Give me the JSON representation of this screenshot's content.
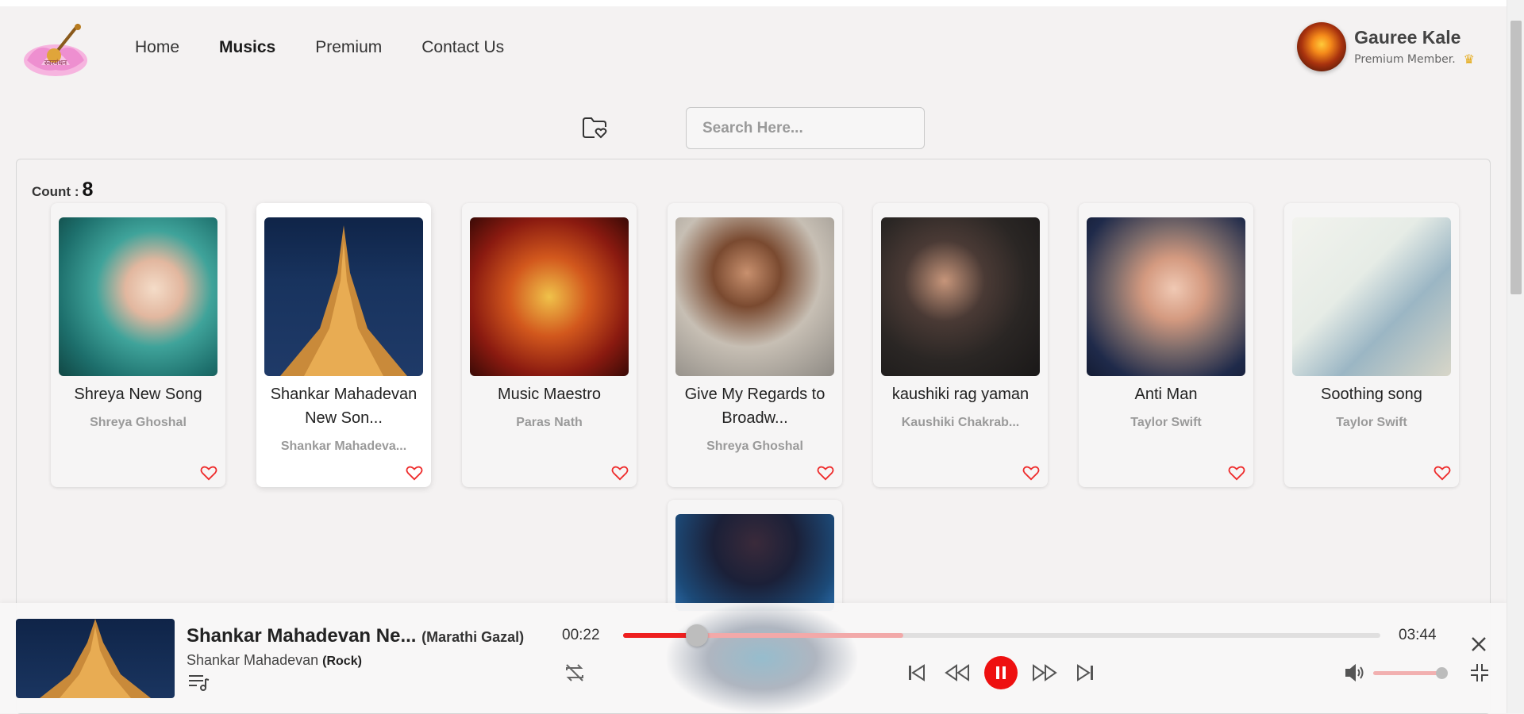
{
  "brand": {
    "logo_text": "स्वरमंथन"
  },
  "nav": {
    "items": [
      "Home",
      "Musics",
      "Premium",
      "Contact Us"
    ],
    "active": "Musics"
  },
  "profile": {
    "name": "Gauree Kale",
    "membership": "Premium Member."
  },
  "search": {
    "placeholder": "Search Here..."
  },
  "library": {
    "count_label": "Count :",
    "count_value": "8",
    "songs": [
      {
        "title": "Shreya New Song",
        "artist": "Shreya Ghoshal"
      },
      {
        "title": "Shankar Mahadevan New Son...",
        "artist": "Shankar Mahadeva..."
      },
      {
        "title": "Music Maestro",
        "artist": "Paras Nath"
      },
      {
        "title": "Give My Regards to Broadw...",
        "artist": "Shreya Ghoshal"
      },
      {
        "title": "kaushiki rag yaman",
        "artist": "Kaushiki Chakrab..."
      },
      {
        "title": "Anti Man",
        "artist": "Taylor Swift"
      },
      {
        "title": "Soothing song",
        "artist": "Taylor Swift"
      },
      {
        "title": "",
        "artist": ""
      }
    ]
  },
  "player": {
    "title": "Shankar Mahadevan Ne...",
    "album": "(Marathi Gazal)",
    "artist": "Shankar Mahadevan",
    "genre": "(Rock)",
    "current_time": "00:22",
    "total_time": "03:44",
    "progress": 0.098,
    "buffered": 0.37,
    "volume": 1.0,
    "accent_color": "#ee1010"
  },
  "icons": [
    "fav-folder-icon",
    "heart-icon",
    "queue-icon",
    "repeat-icon",
    "skip-previous-icon",
    "rewind-icon",
    "pause-icon",
    "fast-forward-icon",
    "skip-next-icon",
    "volume-icon",
    "close-icon",
    "collapse-icon",
    "crown-icon"
  ]
}
